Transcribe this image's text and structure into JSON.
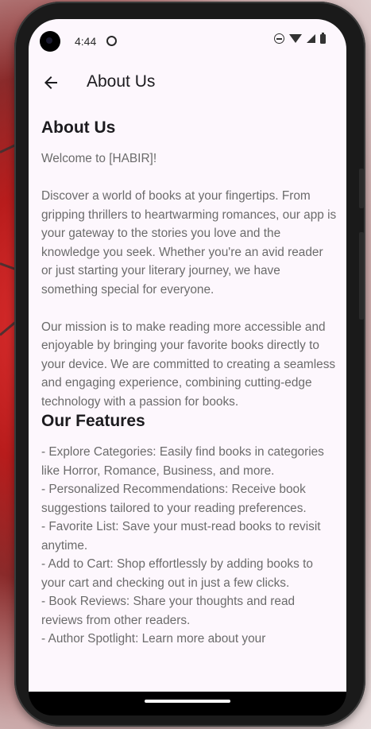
{
  "status_bar": {
    "time": "4:44"
  },
  "app_bar": {
    "title": "About Us"
  },
  "about": {
    "heading": "About Us",
    "welcome": "Welcome to [HABIR]!",
    "paragraph1": "Discover a world of books at your fingertips. From gripping thrillers to heartwarming romances, our app is your gateway to the stories you love and the knowledge you seek. Whether you're an avid reader or just starting your literary journey, we have something special for everyone.",
    "paragraph2": "Our mission is to make reading more accessible and enjoyable by bringing your favorite books directly to your device. We are committed to creating a seamless and engaging experience, combining cutting-edge technology with a passion for books."
  },
  "features": {
    "heading": "Our Features",
    "items": [
      "- Explore Categories: Easily find books in categories like Horror, Romance, Business, and more.",
      "- Personalized Recommendations: Receive book suggestions tailored to your reading preferences.",
      "- Favorite List: Save your must-read books to revisit anytime.",
      "- Add to Cart: Shop effortlessly by adding books to your cart and checking out in just a few clicks.",
      "- Book Reviews: Share your thoughts and read reviews from other readers.",
      "- Author Spotlight: Learn more about your"
    ]
  }
}
